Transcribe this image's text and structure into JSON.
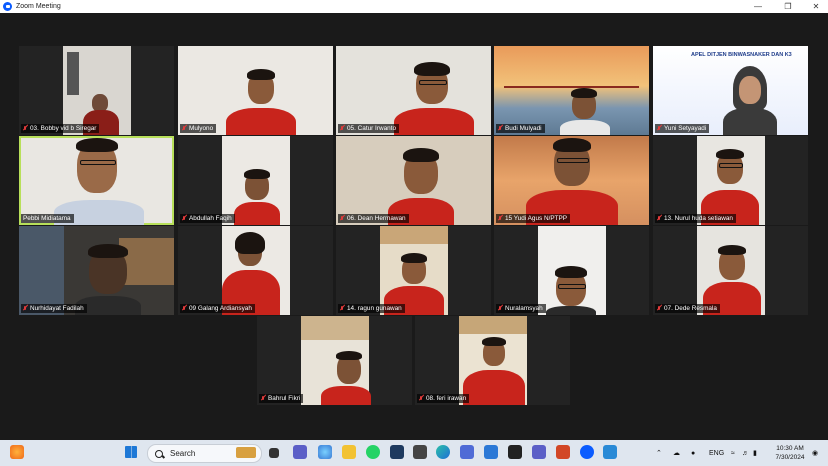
{
  "window": {
    "title": "Zoom Meeting"
  },
  "participants": [
    {
      "name": "03. Bobby vid b Siregar",
      "scene": "door"
    },
    {
      "name": "Mulyono",
      "scene": "wall"
    },
    {
      "name": "05. Catur Irwanto",
      "scene": "wall"
    },
    {
      "name": "Budi Mulyadi",
      "scene": "bridge"
    },
    {
      "name": "Yuni Setyayadi",
      "scene": "banner",
      "banner_text": "APEL DITJEN BINWASNAKER DAN K3"
    },
    {
      "name": "Pebbi Midiatama",
      "scene": "room"
    },
    {
      "name": "Abdullah Faqih",
      "scene": "wall"
    },
    {
      "name": "06. Dean Hermawan",
      "scene": "room"
    },
    {
      "name": "15 Yudi Agus N/PTPP",
      "scene": "sunset"
    },
    {
      "name": "13. Nurul huda setiawan",
      "scene": "wall"
    },
    {
      "name": "Nurhidayat Fadilah",
      "scene": "dark"
    },
    {
      "name": "09 Galang Ardiansyah",
      "scene": "wall"
    },
    {
      "name": "14. ragun gunawan",
      "scene": "wall"
    },
    {
      "name": "Nuralamsyah",
      "scene": "wall"
    },
    {
      "name": "07. Dede Resmala",
      "scene": "wall"
    },
    {
      "name": "Bahrul Fikri",
      "scene": "wall"
    },
    {
      "name": "08. feri irawan",
      "scene": "wall"
    }
  ],
  "taskbar": {
    "search_label": "Search",
    "language": "ENG",
    "time": "10:30 AM",
    "date": "7/30/2024"
  },
  "colors": {
    "active_border": "#b8e05a",
    "muted_mic": "#e23b3b",
    "shirt_red": "#c8241c",
    "zoom_blue": "#0b5cff"
  }
}
